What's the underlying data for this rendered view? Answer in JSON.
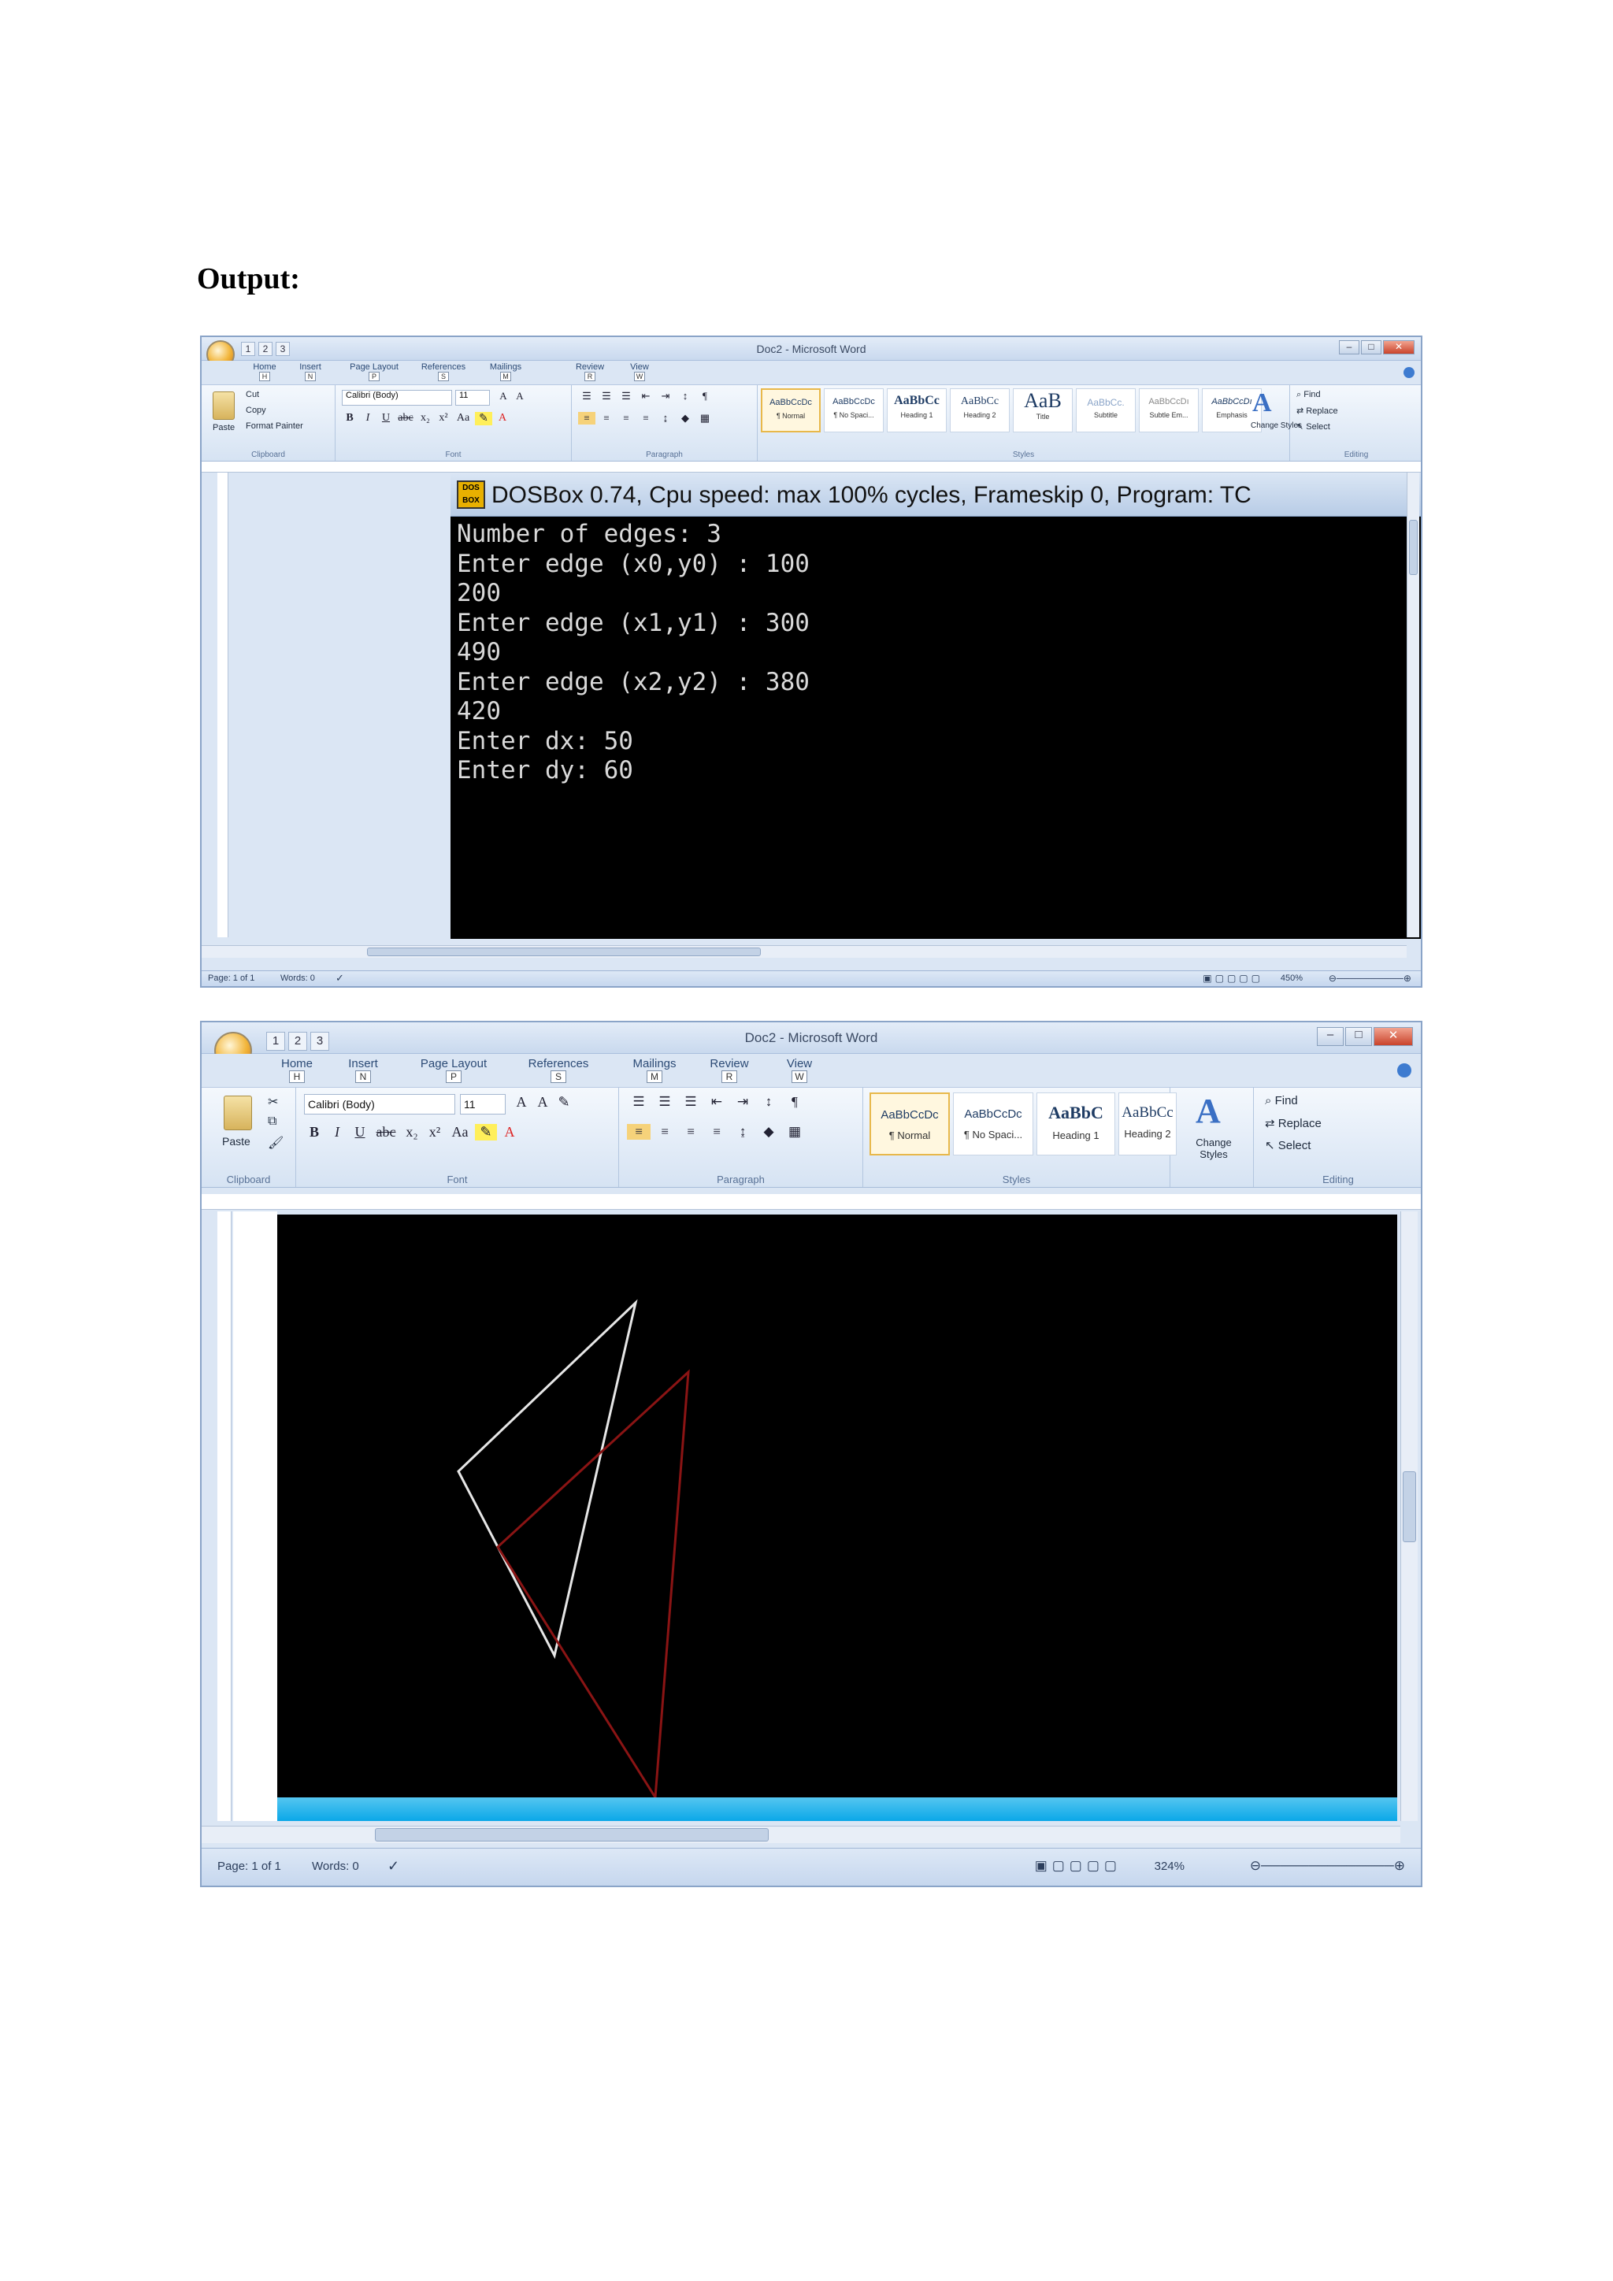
{
  "heading": "Output:",
  "screenshot1": {
    "window_title": "Doc2 - Microsoft Word",
    "qat_keys": [
      "1",
      "2",
      "3"
    ],
    "window_controls": [
      "–",
      "□",
      "✕"
    ],
    "tabs": [
      {
        "label": "Home",
        "key": "H"
      },
      {
        "label": "Insert",
        "key": "N"
      },
      {
        "label": "Page Layout",
        "key": "P"
      },
      {
        "label": "References",
        "key": "S"
      },
      {
        "label": "Mailings",
        "key": "M"
      },
      {
        "label": "Review",
        "key": "R"
      },
      {
        "label": "View",
        "key": "W"
      }
    ],
    "ribbon": {
      "paste": "Paste",
      "cut": "Cut",
      "copy": "Copy",
      "format_painter": "Format Painter",
      "font_name": "Calibri (Body)",
      "font_size": "11",
      "styles": [
        {
          "sample": "AaBbCcDc",
          "name": "¶ Normal"
        },
        {
          "sample": "AaBbCcDc",
          "name": "¶ No Spaci..."
        },
        {
          "sample": "AaBbCc",
          "name": "Heading 1"
        },
        {
          "sample": "AaBbCc",
          "name": "Heading 2"
        },
        {
          "sample": "AaB",
          "name": "Title"
        },
        {
          "sample": "AaBbCc.",
          "name": "Subtitle"
        },
        {
          "sample": "AaBbCcDı",
          "name": "Subtle Em..."
        },
        {
          "sample": "AaBbCcDı",
          "name": "Emphasis"
        }
      ],
      "change_styles": "Change Styles",
      "find": "Find",
      "replace": "Replace",
      "select": "Select",
      "groups": [
        "Clipboard",
        "Font",
        "Paragraph",
        "Styles",
        "Editing"
      ]
    },
    "dosbox": {
      "title": "DOSBox 0.74, Cpu speed: max 100% cycles, Frameskip  0, Program:      TC",
      "icon_text": "DOS BOX",
      "lines": [
        "Number of edges: 3",
        "Enter edge (x0,y0) : 100",
        "200",
        "Enter edge (x1,y1) : 300",
        "490",
        "Enter edge (x2,y2) : 380",
        "420",
        "Enter dx: 50",
        "Enter dy: 60"
      ]
    },
    "status": {
      "page": "Page: 1 of 1",
      "words": "Words: 0",
      "zoom": "450%"
    }
  },
  "screenshot2": {
    "window_title": "Doc2 - Microsoft Word",
    "qat_keys": [
      "1",
      "2",
      "3"
    ],
    "window_controls": [
      "–",
      "□",
      "✕"
    ],
    "tabs": [
      {
        "label": "Home",
        "key": "H"
      },
      {
        "label": "Insert",
        "key": "N"
      },
      {
        "label": "Page Layout",
        "key": "P"
      },
      {
        "label": "References",
        "key": "S"
      },
      {
        "label": "Mailings",
        "key": "M"
      },
      {
        "label": "Review",
        "key": "R"
      },
      {
        "label": "View",
        "key": "W"
      }
    ],
    "ribbon": {
      "paste": "Paste",
      "font_name": "Calibri (Body)",
      "font_size": "11",
      "styles": [
        {
          "sample": "AaBbCcDc",
          "name": "¶ Normal"
        },
        {
          "sample": "AaBbCcDc",
          "name": "¶ No Spaci..."
        },
        {
          "sample": "AaBbC",
          "name": "Heading 1"
        },
        {
          "sample": "AaBbCc",
          "name": "Heading 2"
        }
      ],
      "change_styles": "Change Styles",
      "find": "Find",
      "replace": "Replace",
      "select": "Select",
      "groups": [
        "Clipboard",
        "Font",
        "Paragraph",
        "Styles",
        "Editing"
      ]
    },
    "triangles": {
      "original": {
        "color": "#e6e6e6",
        "note": "white triangle"
      },
      "translated": {
        "color": "#8a1414",
        "note": "red triangle"
      }
    },
    "status": {
      "page": "Page: 1 of 1",
      "words": "Words: 0",
      "zoom": "324%"
    }
  },
  "colors": {
    "ribbon_bg": "#dbe6f4",
    "console_text": "#d9d9d9",
    "console_bg": "#000000",
    "selection": "#e8b84a"
  }
}
